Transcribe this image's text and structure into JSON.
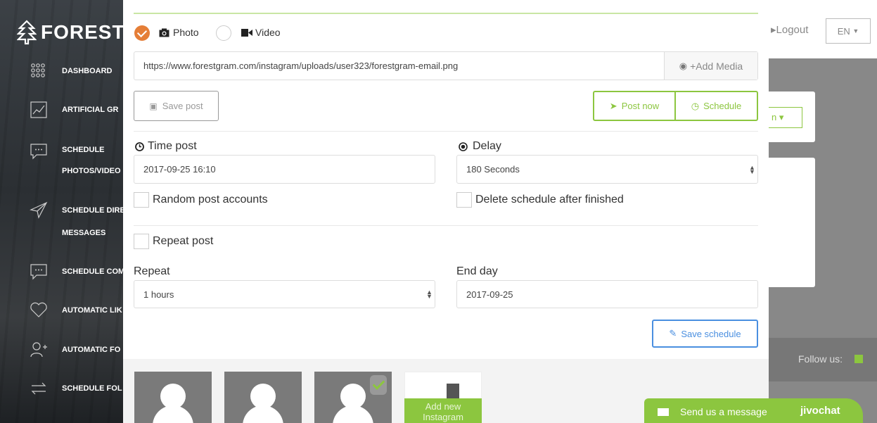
{
  "brand": {
    "logo_text": "FOREST"
  },
  "sidebar": {
    "items": [
      {
        "label": "DASHBOARD",
        "icon": "dots-grid-icon"
      },
      {
        "label": "ARTIFICIAL GR",
        "icon": "chart-line-icon"
      },
      {
        "label": "SCHEDULE",
        "label2": "PHOTOS/VIDEO",
        "icon": "comment-icon"
      },
      {
        "label": "SCHEDULE DIRE",
        "label2": "MESSAGES",
        "icon": "paper-plane-icon"
      },
      {
        "label": "SCHEDULE COM",
        "icon": "comment-icon"
      },
      {
        "label": "AUTOMATIC LIK",
        "icon": "heart-icon"
      },
      {
        "label": "AUTOMATIC FO",
        "icon": "user-plus-icon"
      },
      {
        "label": "SCHEDULE FOL",
        "icon": "repeat-icon"
      }
    ]
  },
  "header": {
    "logout": "Logout",
    "language": "EN"
  },
  "background": {
    "follow_us": "Follow us:"
  },
  "form": {
    "media_type": {
      "photo": "Photo",
      "video": "Video",
      "selected": "Photo"
    },
    "media_url": "https://www.forestgram.com/instagram/uploads/user323/forestgram-email.png",
    "add_media": "+Add Media",
    "save_post": "Save post",
    "post_now": "Post now",
    "schedule": "Schedule",
    "time_post_label": "Time post",
    "time_post_value": "2017-09-25 16:10",
    "delay_label": "Delay",
    "delay_value": "180 Seconds",
    "random_accounts": "Random post accounts",
    "delete_after": "Delete schedule after finished",
    "repeat_post": "Repeat post",
    "repeat_label": "Repeat",
    "repeat_value": "1 hours",
    "end_day_label": "End day",
    "end_day_value": "2017-09-25",
    "save_schedule": "Save schedule"
  },
  "accounts": {
    "add_new": "Add new Instagram"
  },
  "chat": {
    "text": "Send us a message",
    "brand": "jivochat"
  },
  "colors": {
    "accent_green": "#8cc63f",
    "radio_orange": "#e57e37",
    "blue": "#4a8fe0"
  }
}
